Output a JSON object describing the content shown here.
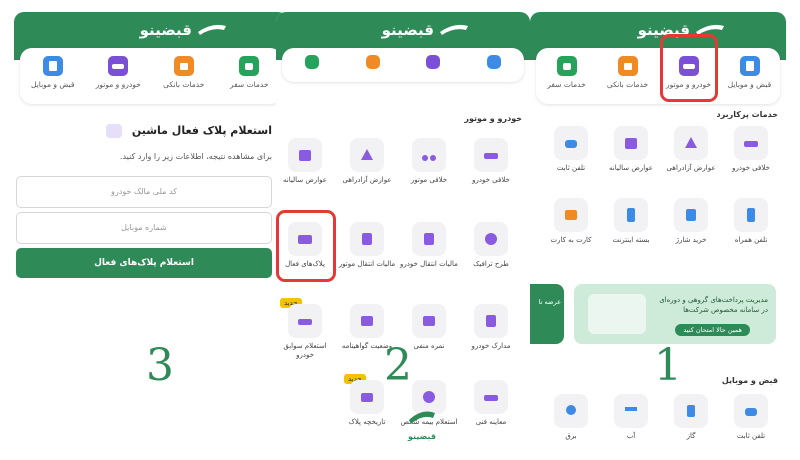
{
  "brand": "قبضینو",
  "tabs": [
    {
      "label": "قبض و موبایل",
      "icon": "bill-icon",
      "color": "#3d8be4"
    },
    {
      "label": "خودرو و موتور",
      "icon": "car-icon",
      "color": "#7b4fd6"
    },
    {
      "label": "خدمات بانکی",
      "icon": "bank-icon",
      "color": "#f08a24"
    },
    {
      "label": "خدمات سفر",
      "icon": "travel-icon",
      "color": "#26a35a"
    }
  ],
  "steps": {
    "one": "1",
    "two": "2",
    "three": "3"
  },
  "panel1": {
    "section_popular": "خدمات پرکاربرد",
    "row1": [
      {
        "label": "خلافی خودرو",
        "icon": "car-fine-icon"
      },
      {
        "label": "عوارض آزادراهی",
        "icon": "highway-toll-icon"
      },
      {
        "label": "عوارض سالیانه",
        "icon": "annual-toll-icon"
      },
      {
        "label": "تلفن ثابت",
        "icon": "landline-phone-icon"
      }
    ],
    "row2": [
      {
        "label": "تلفن همراه",
        "icon": "mobile-phone-icon"
      },
      {
        "label": "خرید شارژ",
        "icon": "charge-icon"
      },
      {
        "label": "بسته اینترنت",
        "icon": "internet-icon"
      },
      {
        "label": "کارت به کارت",
        "icon": "card-transfer-icon"
      }
    ],
    "banner_text": "مدیریت پرداخت‌های گروهی و دوره‌ای در سامانه مخصوص شرکت‌ها",
    "banner_button": "همین حالا امتحان کنید",
    "banner2_text": "عرضه تا",
    "section_bills": "قبض و موبایل",
    "bills": [
      {
        "label": "تلفن ثابت",
        "icon": "landline-phone-icon"
      },
      {
        "label": "گاز",
        "icon": "gas-icon"
      },
      {
        "label": "آب",
        "icon": "water-icon"
      },
      {
        "label": "برق",
        "icon": "electricity-icon"
      }
    ]
  },
  "panel2": {
    "section_title": "خودرو و موتور",
    "row1": [
      {
        "label": "خلافی خودرو",
        "icon": "car-fine-icon"
      },
      {
        "label": "خلافی موتور",
        "icon": "motorcycle-fine-icon"
      },
      {
        "label": "عوارض آزادراهی",
        "icon": "highway-toll-icon"
      },
      {
        "label": "عوارض سالیانه",
        "icon": "annual-toll-icon"
      }
    ],
    "row2": [
      {
        "label": "طرح ترافیک",
        "icon": "traffic-plan-icon"
      },
      {
        "label": "مالیات انتقال خودرو",
        "icon": "car-tax-icon"
      },
      {
        "label": "مالیات انتقال موتور",
        "icon": "motor-tax-icon"
      },
      {
        "label": "پلاک‌های فعال",
        "icon": "active-plates-icon"
      }
    ],
    "row3": [
      {
        "label": "مدارک خودرو",
        "icon": "car-documents-icon"
      },
      {
        "label": "نمره منفی",
        "icon": "negative-points-icon"
      },
      {
        "label": "وضعیت گواهینامه",
        "icon": "license-status-icon"
      },
      {
        "label": "استعلام سوابق خودرو",
        "icon": "car-history-icon"
      }
    ],
    "row4": [
      {
        "label": "معاینه فنی",
        "icon": "inspection-icon"
      },
      {
        "label": "استعلام بیمه شخص",
        "icon": "insurance-icon"
      },
      {
        "label": "تاریخچه پلاک",
        "icon": "plate-history-icon"
      }
    ],
    "new_badge": "جدید",
    "new_badge2": "جدید"
  },
  "panel3": {
    "title": "استعلام پلاک فعال ماشین",
    "description": "برای مشاهده نتیجه، اطلاعات زیر را وارد کنید.",
    "national_id_placeholder": "کد ملی مالک خودرو",
    "mobile_placeholder": "شماره موبایل",
    "submit_label": "استعلام پلاک‌های فعال"
  },
  "watermark_text": "قبضینو"
}
